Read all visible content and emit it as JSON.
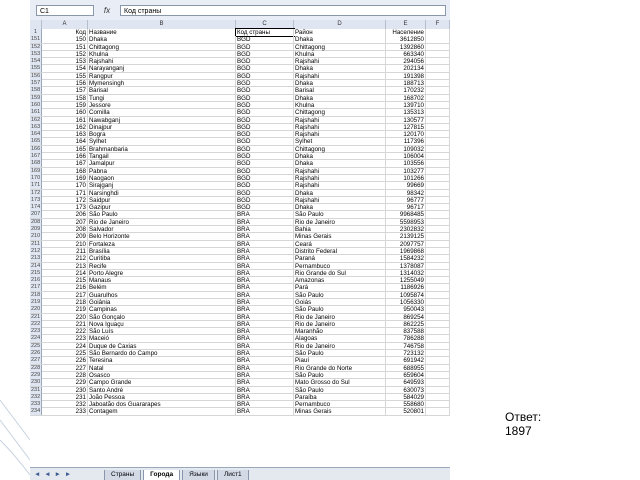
{
  "formula_bar": {
    "cell_ref": "C1",
    "fx": "fx",
    "value": "Код страны"
  },
  "columns": [
    "A",
    "B",
    "C",
    "D",
    "E",
    "F"
  ],
  "headers": [
    "Код",
    "Название",
    "Код страны",
    "Район",
    "Население"
  ],
  "rows": [
    {
      "n": "151",
      "id": "150",
      "name": "Dhaka",
      "cc": "BGD",
      "dist": "Dhaka",
      "pop": "3612850"
    },
    {
      "n": "152",
      "id": "151",
      "name": "Chittagong",
      "cc": "BGD",
      "dist": "Chittagong",
      "pop": "1392860"
    },
    {
      "n": "153",
      "id": "152",
      "name": "Khulna",
      "cc": "BGD",
      "dist": "Khulna",
      "pop": "663340"
    },
    {
      "n": "154",
      "id": "153",
      "name": "Rajshahi",
      "cc": "BGD",
      "dist": "Rajshahi",
      "pop": "294056"
    },
    {
      "n": "155",
      "id": "154",
      "name": "Narayanganj",
      "cc": "BGD",
      "dist": "Dhaka",
      "pop": "202134"
    },
    {
      "n": "156",
      "id": "155",
      "name": "Rangpur",
      "cc": "BGD",
      "dist": "Rajshahi",
      "pop": "191398"
    },
    {
      "n": "157",
      "id": "156",
      "name": "Mymensingh",
      "cc": "BGD",
      "dist": "Dhaka",
      "pop": "188713"
    },
    {
      "n": "158",
      "id": "157",
      "name": "Barisal",
      "cc": "BGD",
      "dist": "Barisal",
      "pop": "170232"
    },
    {
      "n": "159",
      "id": "158",
      "name": "Tungi",
      "cc": "BGD",
      "dist": "Dhaka",
      "pop": "168702"
    },
    {
      "n": "160",
      "id": "159",
      "name": "Jessore",
      "cc": "BGD",
      "dist": "Khulna",
      "pop": "139710"
    },
    {
      "n": "161",
      "id": "160",
      "name": "Comilla",
      "cc": "BGD",
      "dist": "Chittagong",
      "pop": "135313"
    },
    {
      "n": "162",
      "id": "161",
      "name": "Nawabganj",
      "cc": "BGD",
      "dist": "Rajshahi",
      "pop": "130577"
    },
    {
      "n": "163",
      "id": "162",
      "name": "Dinajpur",
      "cc": "BGD",
      "dist": "Rajshahi",
      "pop": "127815"
    },
    {
      "n": "164",
      "id": "163",
      "name": "Bogra",
      "cc": "BGD",
      "dist": "Rajshahi",
      "pop": "120170"
    },
    {
      "n": "165",
      "id": "164",
      "name": "Sylhet",
      "cc": "BGD",
      "dist": "Sylhet",
      "pop": "117396"
    },
    {
      "n": "166",
      "id": "165",
      "name": "Brahmanbaria",
      "cc": "BGD",
      "dist": "Chittagong",
      "pop": "109032"
    },
    {
      "n": "167",
      "id": "166",
      "name": "Tangail",
      "cc": "BGD",
      "dist": "Dhaka",
      "pop": "106004"
    },
    {
      "n": "168",
      "id": "167",
      "name": "Jamalpur",
      "cc": "BGD",
      "dist": "Dhaka",
      "pop": "103556"
    },
    {
      "n": "169",
      "id": "168",
      "name": "Pabna",
      "cc": "BGD",
      "dist": "Rajshahi",
      "pop": "103277"
    },
    {
      "n": "170",
      "id": "169",
      "name": "Naogaon",
      "cc": "BGD",
      "dist": "Rajshahi",
      "pop": "101266"
    },
    {
      "n": "171",
      "id": "170",
      "name": "Sirajganj",
      "cc": "BGD",
      "dist": "Rajshahi",
      "pop": "99669"
    },
    {
      "n": "172",
      "id": "171",
      "name": "Narsinghdi",
      "cc": "BGD",
      "dist": "Dhaka",
      "pop": "98342"
    },
    {
      "n": "173",
      "id": "172",
      "name": "Saidpur",
      "cc": "BGD",
      "dist": "Rajshahi",
      "pop": "96777"
    },
    {
      "n": "174",
      "id": "173",
      "name": "Gazipur",
      "cc": "BGD",
      "dist": "Dhaka",
      "pop": "96717"
    },
    {
      "n": "207",
      "id": "206",
      "name": "São Paulo",
      "cc": "BRA",
      "dist": "São Paulo",
      "pop": "9968485"
    },
    {
      "n": "208",
      "id": "207",
      "name": "Rio de Janeiro",
      "cc": "BRA",
      "dist": "Rio de Janeiro",
      "pop": "5598953"
    },
    {
      "n": "209",
      "id": "208",
      "name": "Salvador",
      "cc": "BRA",
      "dist": "Bahia",
      "pop": "2302832"
    },
    {
      "n": "210",
      "id": "209",
      "name": "Belo Horizonte",
      "cc": "BRA",
      "dist": "Minas Gerais",
      "pop": "2139125"
    },
    {
      "n": "211",
      "id": "210",
      "name": "Fortaleza",
      "cc": "BRA",
      "dist": "Ceará",
      "pop": "2097757"
    },
    {
      "n": "212",
      "id": "211",
      "name": "Brasília",
      "cc": "BRA",
      "dist": "Distrito Federal",
      "pop": "1969868"
    },
    {
      "n": "213",
      "id": "212",
      "name": "Curitiba",
      "cc": "BRA",
      "dist": "Paraná",
      "pop": "1584232"
    },
    {
      "n": "214",
      "id": "213",
      "name": "Recife",
      "cc": "BRA",
      "dist": "Pernambuco",
      "pop": "1378087"
    },
    {
      "n": "215",
      "id": "214",
      "name": "Porto Alegre",
      "cc": "BRA",
      "dist": "Rio Grande do Sul",
      "pop": "1314032"
    },
    {
      "n": "216",
      "id": "215",
      "name": "Manaus",
      "cc": "BRA",
      "dist": "Amazonas",
      "pop": "1255049"
    },
    {
      "n": "217",
      "id": "216",
      "name": "Belém",
      "cc": "BRA",
      "dist": "Pará",
      "pop": "1186926"
    },
    {
      "n": "218",
      "id": "217",
      "name": "Guarulhos",
      "cc": "BRA",
      "dist": "São Paulo",
      "pop": "1095874"
    },
    {
      "n": "219",
      "id": "218",
      "name": "Goiânia",
      "cc": "BRA",
      "dist": "Goiás",
      "pop": "1056330"
    },
    {
      "n": "220",
      "id": "219",
      "name": "Campinas",
      "cc": "BRA",
      "dist": "São Paulo",
      "pop": "950043"
    },
    {
      "n": "221",
      "id": "220",
      "name": "São Gonçalo",
      "cc": "BRA",
      "dist": "Rio de Janeiro",
      "pop": "869254"
    },
    {
      "n": "222",
      "id": "221",
      "name": "Nova Iguaçu",
      "cc": "BRA",
      "dist": "Rio de Janeiro",
      "pop": "862225"
    },
    {
      "n": "223",
      "id": "222",
      "name": "São Luís",
      "cc": "BRA",
      "dist": "Maranhão",
      "pop": "837588"
    },
    {
      "n": "224",
      "id": "223",
      "name": "Maceió",
      "cc": "BRA",
      "dist": "Alagoas",
      "pop": "786288"
    },
    {
      "n": "225",
      "id": "224",
      "name": "Duque de Caxias",
      "cc": "BRA",
      "dist": "Rio de Janeiro",
      "pop": "746758"
    },
    {
      "n": "226",
      "id": "225",
      "name": "São Bernardo do Campo",
      "cc": "BRA",
      "dist": "São Paulo",
      "pop": "723132"
    },
    {
      "n": "227",
      "id": "226",
      "name": "Teresina",
      "cc": "BRA",
      "dist": "Piauí",
      "pop": "691942"
    },
    {
      "n": "228",
      "id": "227",
      "name": "Natal",
      "cc": "BRA",
      "dist": "Rio Grande do Norte",
      "pop": "688955"
    },
    {
      "n": "229",
      "id": "228",
      "name": "Osasco",
      "cc": "BRA",
      "dist": "São Paulo",
      "pop": "659604"
    },
    {
      "n": "230",
      "id": "229",
      "name": "Campo Grande",
      "cc": "BRA",
      "dist": "Mato Grosso do Sul",
      "pop": "649593"
    },
    {
      "n": "231",
      "id": "230",
      "name": "Santo André",
      "cc": "BRA",
      "dist": "São Paulo",
      "pop": "630073"
    },
    {
      "n": "232",
      "id": "231",
      "name": "João Pessoa",
      "cc": "BRA",
      "dist": "Paraíba",
      "pop": "584029"
    },
    {
      "n": "233",
      "id": "232",
      "name": "Jaboatão dos Guararapes",
      "cc": "BRA",
      "dist": "Pernambuco",
      "pop": "558680"
    },
    {
      "n": "234",
      "id": "233",
      "name": "Contagem",
      "cc": "BRA",
      "dist": "Minas Gerais",
      "pop": "520801"
    }
  ],
  "tabs": [
    "Страны",
    "Города",
    "Языки",
    "Лист1"
  ],
  "active_tab": "Города",
  "tab_nav": "◄ ◄ ► ►",
  "answer": {
    "label": "Ответ:",
    "value": "1897"
  }
}
